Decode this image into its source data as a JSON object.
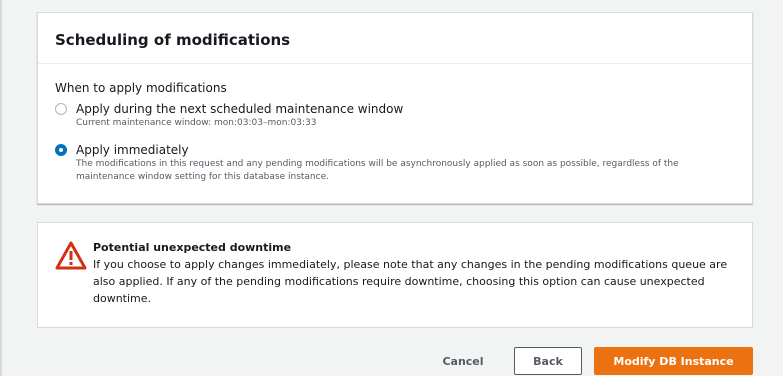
{
  "scheduling": {
    "title": "Scheduling of modifications",
    "group_label": "When to apply modifications",
    "options": [
      {
        "label": "Apply during the next scheduled maintenance window",
        "description": "Current maintenance window: mon:03:03–mon:03:33",
        "selected": false
      },
      {
        "label": "Apply immediately",
        "description": "The modifications in this request and any pending modifications will be asynchronously applied as soon as possible, regardless of the maintenance window setting for this database instance.",
        "selected": true
      }
    ]
  },
  "alert": {
    "icon": "warning-triangle-icon",
    "title": "Potential unexpected downtime",
    "text": "If you choose to apply changes immediately, please note that any changes in the pending modifications queue are also applied. If any of the pending modifications require downtime, choosing this option can cause unexpected downtime."
  },
  "actions": {
    "cancel_label": "Cancel",
    "back_label": "Back",
    "submit_label": "Modify DB Instance"
  },
  "colors": {
    "primary": "#ec7211",
    "radio_selected": "#0073bb",
    "error": "#d13212"
  }
}
